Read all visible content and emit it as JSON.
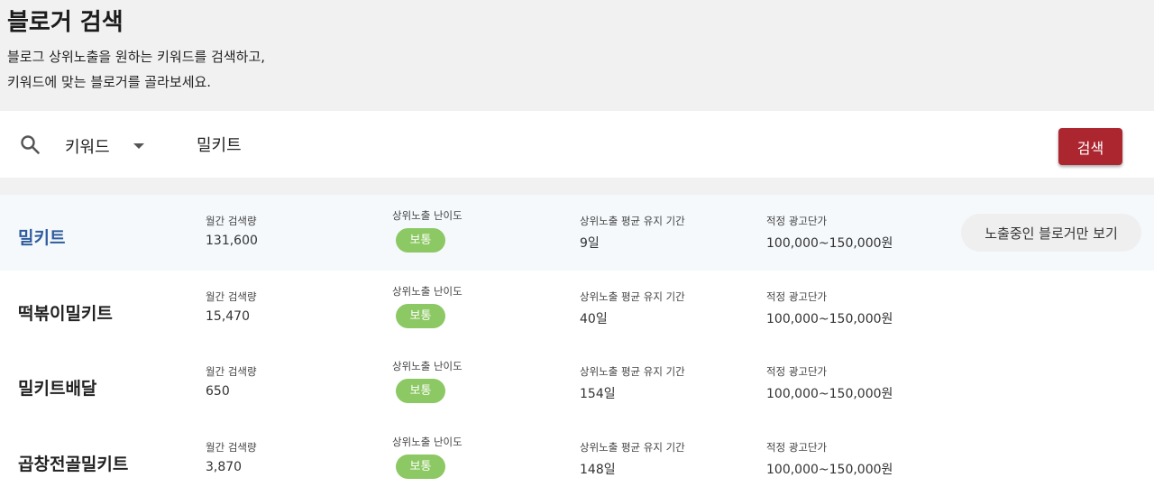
{
  "header": {
    "title": "블로거 검색",
    "description_line1": "블로그 상위노출을 원하는 키워드를 검색하고,",
    "description_line2": "키워드에 맞는 블로거를 골라보세요."
  },
  "search": {
    "icon": "search-icon",
    "type_selected": "키워드",
    "query": "밀키트",
    "button_label": "검색"
  },
  "results": [
    {
      "keyword": "밀키트",
      "monthly_search_label": "월간 검색량",
      "monthly_search": "131,600",
      "difficulty_label": "상위노출 난이도",
      "difficulty": "보통",
      "duration_label": "상위노출 평균 유지 기간",
      "duration": "9일",
      "price_label": "적정 광고단가",
      "price": "100,000~150,000원",
      "action_label": "노출중인 블로거만 보기"
    },
    {
      "keyword": "떡볶이밀키트",
      "monthly_search_label": "월간 검색량",
      "monthly_search": "15,470",
      "difficulty_label": "상위노출 난이도",
      "difficulty": "보통",
      "duration_label": "상위노출 평균 유지 기간",
      "duration": "40일",
      "price_label": "적정 광고단가",
      "price": "100,000~150,000원"
    },
    {
      "keyword": "밀키트배달",
      "monthly_search_label": "월간 검색량",
      "monthly_search": "650",
      "difficulty_label": "상위노출 난이도",
      "difficulty": "보통",
      "duration_label": "상위노출 평균 유지 기간",
      "duration": "154일",
      "price_label": "적정 광고단가",
      "price": "100,000~150,000원"
    },
    {
      "keyword": "곱창전골밀키트",
      "monthly_search_label": "월간 검색량",
      "monthly_search": "3,870",
      "difficulty_label": "상위노출 난이도",
      "difficulty": "보통",
      "duration_label": "상위노출 평균 유지 기간",
      "duration": "148일",
      "price_label": "적정 광고단가",
      "price": "100,000~150,000원"
    }
  ],
  "colors": {
    "accent_button": "#ac2630",
    "badge_green": "#8cc863",
    "highlight_keyword": "#2f5c9e"
  }
}
